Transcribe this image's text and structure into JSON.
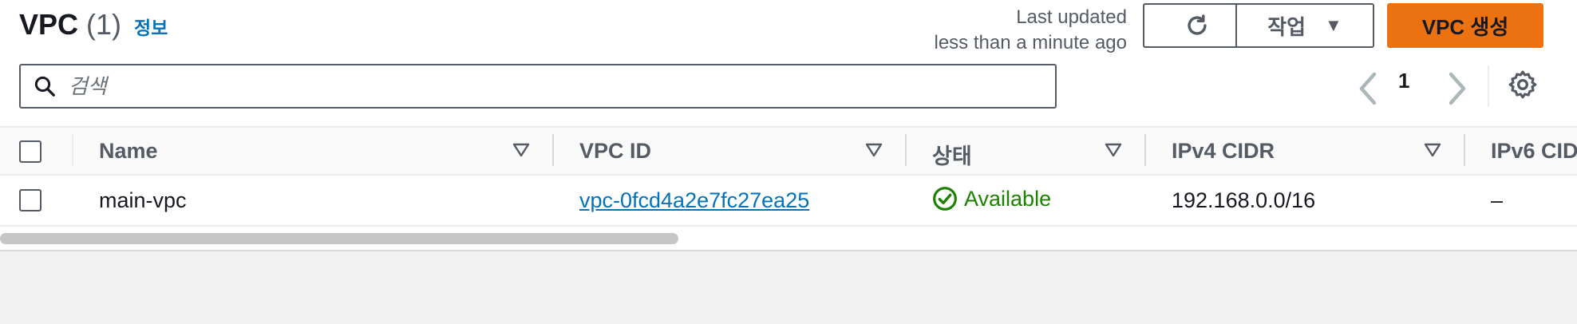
{
  "header": {
    "title": "VPC",
    "count": "(1)",
    "info_link": "정보",
    "last_updated_line1": "Last updated",
    "last_updated_line2": "less than a minute ago",
    "actions_label": "작업",
    "create_label": "VPC 생성"
  },
  "search": {
    "placeholder": "검색",
    "value": ""
  },
  "pagination": {
    "current_page": "1"
  },
  "table": {
    "columns": [
      "Name",
      "VPC ID",
      "상태",
      "IPv4 CIDR",
      "IPv6 CID"
    ],
    "rows": [
      {
        "name": "main-vpc",
        "vpc_id": "vpc-0fcd4a2e7fc27ea25",
        "status": "Available",
        "ipv4_cidr": "192.168.0.0/16",
        "ipv6_cidr": "–"
      }
    ]
  },
  "icons": {
    "refresh": "refresh-icon",
    "caret": "caret-down-icon",
    "search": "search-icon",
    "prev": "chevron-left-icon",
    "next": "chevron-right-icon",
    "settings": "gear-icon",
    "status": "check-circle-icon",
    "filter": "sort-caret-icon"
  },
  "colors": {
    "accent_orange": "#ec7211",
    "link_blue": "#0073bb",
    "status_green": "#1d8102"
  }
}
